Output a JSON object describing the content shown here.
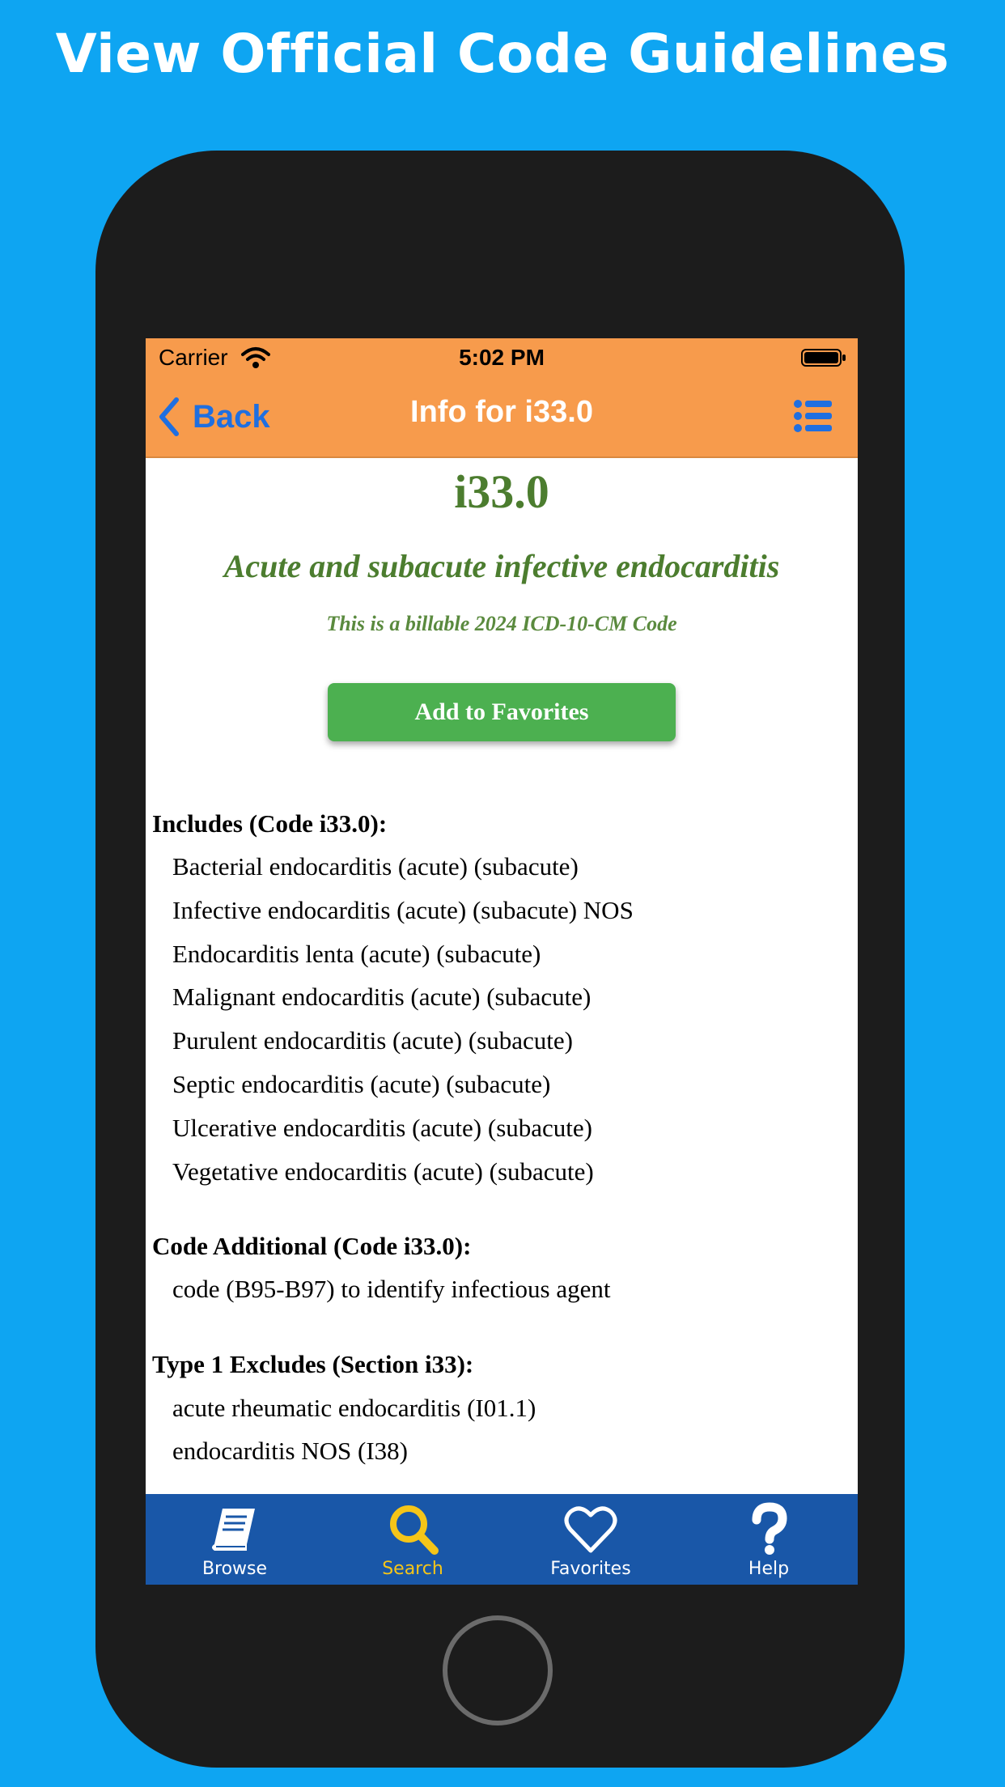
{
  "headline": "View Official Code Guidelines",
  "status": {
    "carrier": "Carrier",
    "time": "5:02 PM"
  },
  "nav": {
    "back_label": "Back",
    "title": "Info for i33.0"
  },
  "detail": {
    "code": "i33.0",
    "description": "Acute and subacute infective endocarditis",
    "billable": "This is a billable 2024 ICD-10-CM Code",
    "favorites_button": "Add to Favorites"
  },
  "sections": [
    {
      "title": "Includes (Code i33.0):",
      "items": [
        "Bacterial endocarditis (acute) (subacute)",
        "Infective endocarditis (acute) (subacute) NOS",
        "Endocarditis lenta (acute) (subacute)",
        "Malignant endocarditis (acute) (subacute)",
        "Purulent endocarditis (acute) (subacute)",
        "Septic endocarditis (acute) (subacute)",
        "Ulcerative endocarditis (acute) (subacute)",
        "Vegetative endocarditis (acute) (subacute)"
      ]
    },
    {
      "title": "Code Additional (Code i33.0):",
      "items": [
        "code (B95-B97) to identify infectious agent"
      ]
    },
    {
      "title": "Type 1 Excludes (Section i33):",
      "items": [
        "acute rheumatic endocarditis (I01.1)",
        "endocarditis NOS (I38)"
      ]
    }
  ],
  "tabs": [
    {
      "label": "Browse",
      "icon": "book-icon",
      "active": false
    },
    {
      "label": "Search",
      "icon": "search-icon",
      "active": true
    },
    {
      "label": "Favorites",
      "icon": "heart-icon",
      "active": false
    },
    {
      "label": "Help",
      "icon": "question-icon",
      "active": false
    }
  ],
  "colors": {
    "background": "#0ea5f2",
    "nav_bar": "#f79b4c",
    "tab_bar": "#1957a8",
    "tab_active": "#f5c518",
    "code_green": "#4c7d2f",
    "button_green": "#4cb050",
    "back_blue": "#1f6fe0"
  }
}
